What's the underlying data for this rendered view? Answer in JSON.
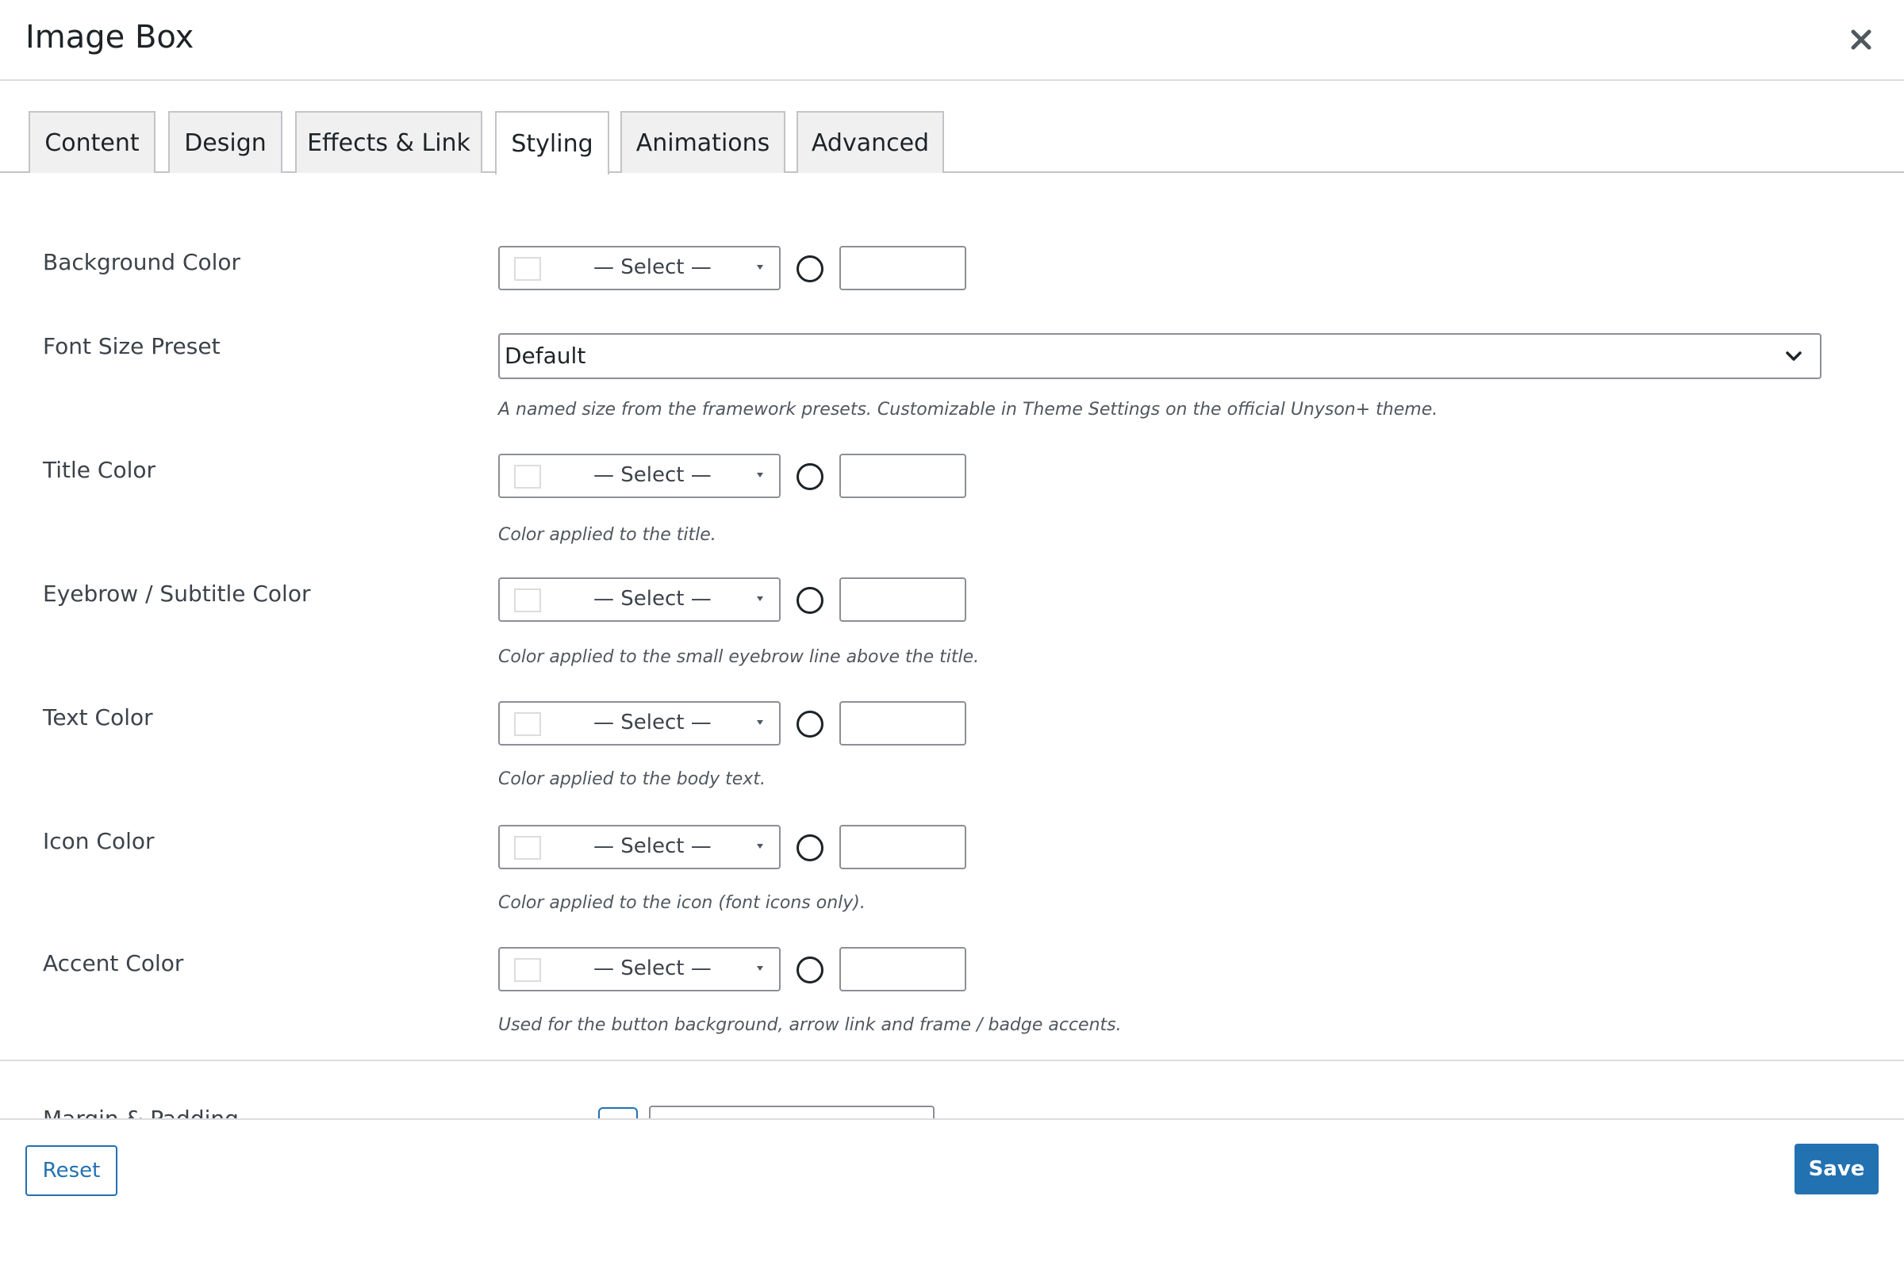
{
  "modal": {
    "title": "Image Box",
    "close_icon": "close-icon"
  },
  "tabs": [
    {
      "label": "Content"
    },
    {
      "label": "Design"
    },
    {
      "label": "Effects & Link"
    },
    {
      "label": "Styling",
      "active": true
    },
    {
      "label": "Animations"
    },
    {
      "label": "Advanced"
    }
  ],
  "fields": {
    "background_color": {
      "label": "Background Color",
      "select": "— Select —"
    },
    "font_size_preset": {
      "label": "Font Size Preset",
      "value": "Default",
      "help": "A named size from the framework presets. Customizable in Theme Settings on the official Unyson+ theme."
    },
    "title_color": {
      "label": "Title Color",
      "select": "— Select —",
      "help": "Color applied to the title."
    },
    "eyebrow_color": {
      "label": "Eyebrow / Subtitle Color",
      "select": "— Select —",
      "help": "Color applied to the small eyebrow line above the title."
    },
    "text_color": {
      "label": "Text Color",
      "select": "— Select —",
      "help": "Color applied to the body text."
    },
    "icon_color": {
      "label": "Icon Color",
      "select": "— Select —",
      "help": "Color applied to the icon (font icons only)."
    },
    "accent_color": {
      "label": "Accent Color",
      "select": "— Select —",
      "help": "Used for the button background, arrow link and frame / badge accents."
    },
    "margin_padding": {
      "label": "Margin & Padding"
    }
  },
  "footer": {
    "reset_label": "Reset",
    "save_label": "Save"
  },
  "colors": {
    "primary": "#2271b1",
    "border": "#8c8f94",
    "text": "#1d2327",
    "muted": "#50575e"
  }
}
